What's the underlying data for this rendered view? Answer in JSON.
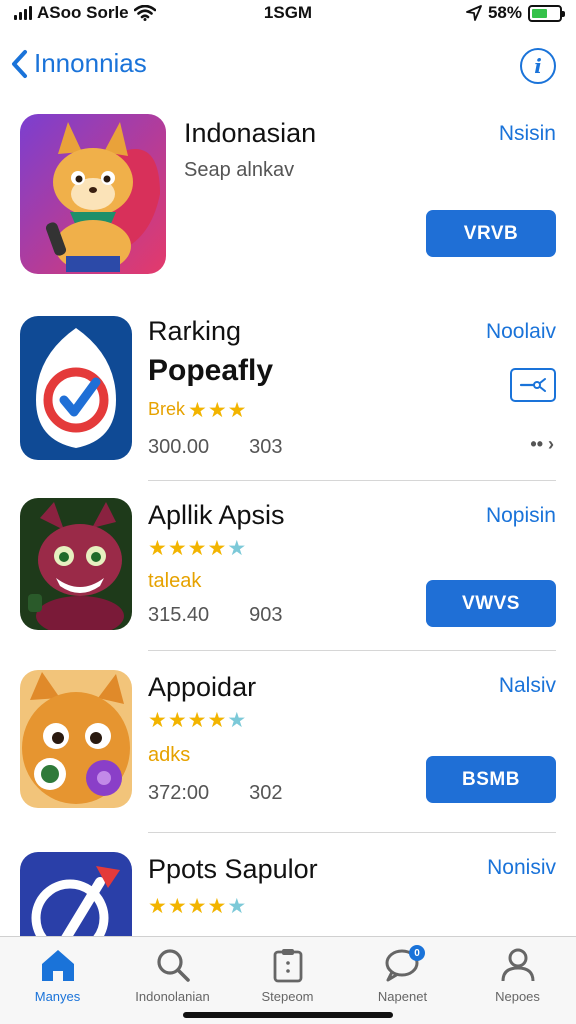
{
  "status_bar": {
    "carrier": "ASoo Sorle",
    "time": "1SGM",
    "battery_percent": "58%",
    "battery_level": 0.58
  },
  "nav": {
    "back_label": "Innonnias"
  },
  "apps": [
    {
      "name": "Indonasian",
      "subtitle": "Seap alnkav",
      "tag": "Nsisin",
      "action": "VRVB"
    },
    {
      "name": "Rarking",
      "subtitle_bold": "Popeafly",
      "rating_text": "Brek",
      "tag": "Noolaiv",
      "stat_a": "300.00",
      "stat_b": "303",
      "rating": 3
    },
    {
      "name": "Apllik Apsis",
      "subtitle": "taleak",
      "tag": "Nopisin",
      "stat_a": "315.40",
      "stat_b": "903",
      "action": "VWVS",
      "rating": 4.5
    },
    {
      "name": "Appoidar",
      "subtitle": "adks",
      "tag": "Nalsiv",
      "stat_a": "372:00",
      "stat_b": "302",
      "action": "BSMB",
      "rating": 4.5
    },
    {
      "name": "Ppots Sapulor",
      "tag": "Nonisiv",
      "rating": 4.5
    }
  ],
  "tabs": [
    {
      "label": "Manyes",
      "icon": "home-icon",
      "active": true
    },
    {
      "label": "Indonolanian",
      "icon": "search-icon",
      "active": false
    },
    {
      "label": "Stepeom",
      "icon": "clipboard-icon",
      "active": false
    },
    {
      "label": "Napenet",
      "icon": "chat-icon",
      "active": false,
      "badge": "0"
    },
    {
      "label": "Nepoes",
      "icon": "profile-icon",
      "active": false
    }
  ],
  "colors": {
    "accent": "#1a73d9",
    "button": "#1f6fd6",
    "star": "#f2b400",
    "battery": "#35c24a"
  }
}
